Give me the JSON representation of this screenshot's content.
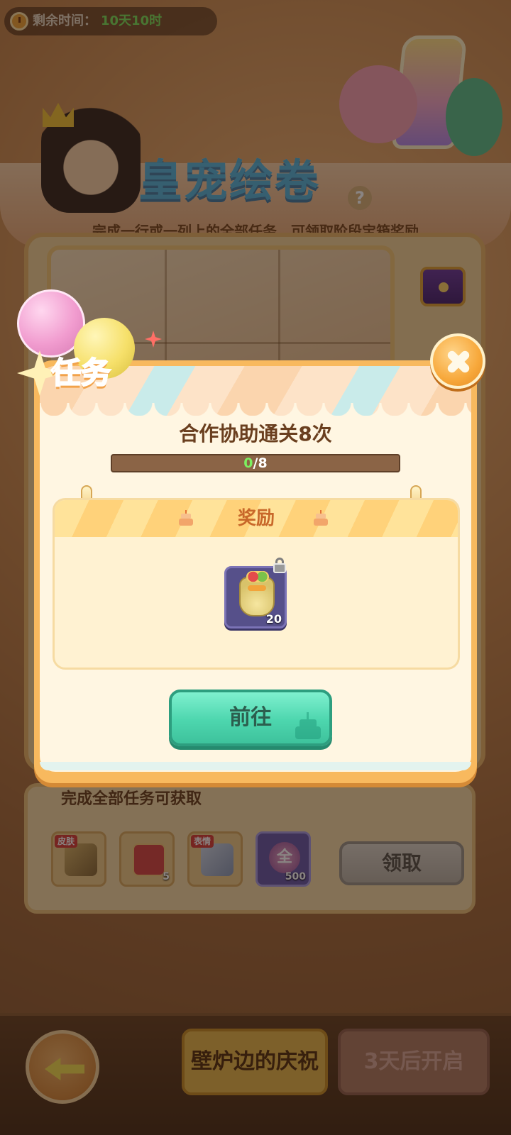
{
  "timer": {
    "label": "剩余时间：",
    "value": "10天10时"
  },
  "event": {
    "title": "皇宠绘卷",
    "help_symbol": "?",
    "subtitle": "完成一行或一列上的全部任务，可领取阶段宝箱奖励"
  },
  "completion_reward": {
    "title": "完成全部任务可获取",
    "items": [
      {
        "tag": "皮肤",
        "count": "",
        "icon": "skin-staff-icon"
      },
      {
        "tag": "",
        "count": "5",
        "icon": "dice-icon"
      },
      {
        "tag": "表情",
        "count": "",
        "icon": "emote-cart-icon"
      },
      {
        "tag": "",
        "count": "500",
        "icon": "coin-icon",
        "symbol": "全"
      }
    ],
    "claim_label": "领取"
  },
  "footer": {
    "stage_active": "壁炉边的庆祝",
    "stage_locked": "3天后开启"
  },
  "modal": {
    "title": "任务",
    "task_name": "合作协助通关8次",
    "progress": {
      "current": "0",
      "separator": "/",
      "total": "8",
      "fraction": 0
    },
    "reward_header": "奖励",
    "reward_item": {
      "icon": "gift-bag-icon",
      "count": "20",
      "locked": true
    },
    "go_label": "前往"
  },
  "colors": {
    "modal_border": "#f8b95e",
    "go_button": "#4dd6ae",
    "title_accent": "#ff7a3c",
    "progress_fill": "#62d66a"
  }
}
